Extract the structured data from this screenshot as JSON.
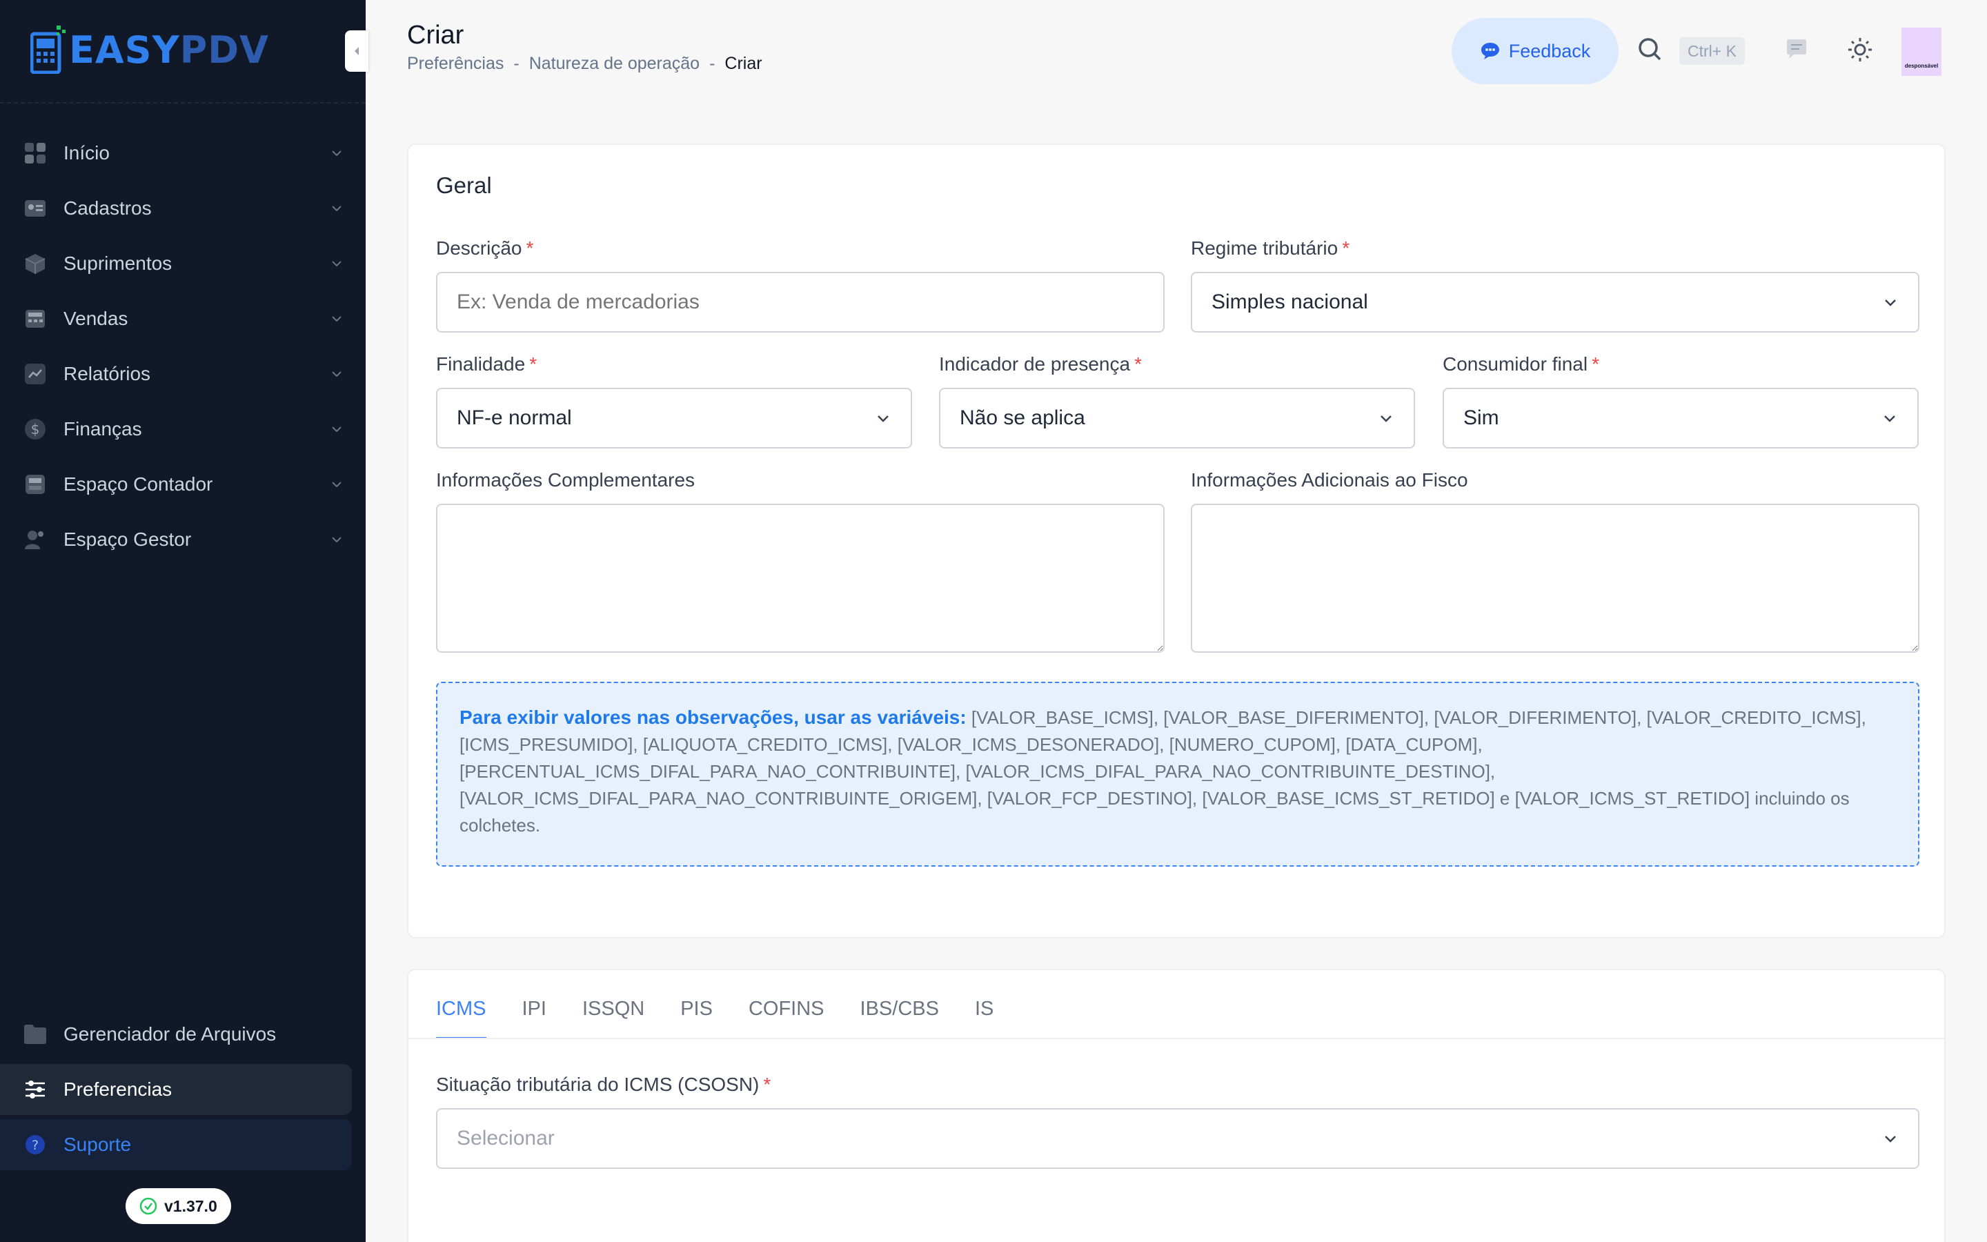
{
  "brand": {
    "logo_easy": "EASY",
    "logo_pdv": "PDV"
  },
  "sidebar": {
    "items": [
      {
        "label": "Início",
        "icon": "grid-icon"
      },
      {
        "label": "Cadastros",
        "icon": "id-card-icon"
      },
      {
        "label": "Suprimentos",
        "icon": "box-icon"
      },
      {
        "label": "Vendas",
        "icon": "register-icon"
      },
      {
        "label": "Relatórios",
        "icon": "chart-icon"
      },
      {
        "label": "Finanças",
        "icon": "dollar-icon"
      },
      {
        "label": "Espaço Contador",
        "icon": "calculator-icon"
      },
      {
        "label": "Espaço Gestor",
        "icon": "manager-icon"
      }
    ],
    "bottom": [
      {
        "label": "Gerenciador de Arquivos",
        "icon": "folder-icon"
      },
      {
        "label": "Preferencias",
        "icon": "sliders-icon"
      },
      {
        "label": "Suporte",
        "icon": "help-icon"
      }
    ],
    "version": "v1.37.0"
  },
  "header": {
    "title": "Criar",
    "breadcrumb": [
      "Preferências",
      "Natureza de operação",
      "Criar"
    ],
    "feedback": "Feedback",
    "shortcut": "Ctrl+ K",
    "avatar_text": "desponsável"
  },
  "form": {
    "section_title": "Geral",
    "descricao": {
      "label": "Descrição",
      "placeholder": "Ex: Venda de mercadorias"
    },
    "regime": {
      "label": "Regime tributário",
      "value": "Simples nacional"
    },
    "finalidade": {
      "label": "Finalidade",
      "value": "NF-e normal"
    },
    "presenca": {
      "label": "Indicador de presença",
      "value": "Não se aplica"
    },
    "consumidor": {
      "label": "Consumidor final",
      "value": "Sim"
    },
    "info_comp": {
      "label": "Informações Complementares"
    },
    "info_fisco": {
      "label": "Informações Adicionais ao Fisco"
    },
    "info_box": {
      "highlight": "Para exibir valores nas observações, usar as variáveis:",
      "text": " [VALOR_BASE_ICMS], [VALOR_BASE_DIFERIMENTO], [VALOR_DIFERIMENTO], [VALOR_CREDITO_ICMS], [ICMS_PRESUMIDO], [ALIQUOTA_CREDITO_ICMS], [VALOR_ICMS_DESONERADO], [NUMERO_CUPOM], [DATA_CUPOM], [PERCENTUAL_ICMS_DIFAL_PARA_NAO_CONTRIBUINTE], [VALOR_ICMS_DIFAL_PARA_NAO_CONTRIBUINTE_DESTINO], [VALOR_ICMS_DIFAL_PARA_NAO_CONTRIBUINTE_ORIGEM], [VALOR_FCP_DESTINO], [VALOR_BASE_ICMS_ST_RETIDO] e [VALOR_ICMS_ST_RETIDO] incluindo os colchetes."
    }
  },
  "tax": {
    "tabs": [
      "ICMS",
      "IPI",
      "ISSQN",
      "PIS",
      "COFINS",
      "IBS/CBS",
      "IS"
    ],
    "csosn": {
      "label": "Situação tributária do ICMS (CSOSN)",
      "placeholder": "Selecionar"
    }
  },
  "colors": {
    "accent": "#3b82f6",
    "sidebar_bg": "#111827",
    "required": "#ef4444"
  }
}
